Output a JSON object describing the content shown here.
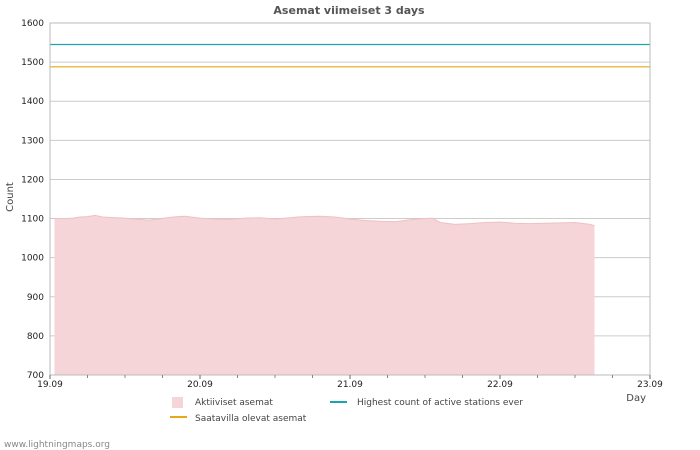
{
  "chart_data": {
    "type": "area",
    "title": "Asemat viimeiset 3 days",
    "xlabel": "Day",
    "ylabel": "Count",
    "x_ticks": [
      "19.09",
      "20.09",
      "21.09",
      "22.09",
      "23.09"
    ],
    "xlim": [
      0,
      4
    ],
    "ylim": [
      700,
      1600
    ],
    "y_ticks": [
      700,
      800,
      900,
      1000,
      1100,
      1200,
      1300,
      1400,
      1500,
      1600
    ],
    "grid": true,
    "legend_position": "bottom",
    "series": [
      {
        "name": "Aktiiviset asemat",
        "kind": "area",
        "color": "#f5d5d7",
        "x": [
          0.03,
          0.1,
          0.15,
          0.2,
          0.25,
          0.3,
          0.35,
          0.4,
          0.5,
          0.6,
          0.65,
          0.7,
          0.8,
          0.85,
          0.9,
          1.0,
          1.1,
          1.2,
          1.3,
          1.4,
          1.5,
          1.6,
          1.65,
          1.7,
          1.8,
          1.9,
          2.0,
          2.1,
          2.2,
          2.3,
          2.4,
          2.5,
          2.55,
          2.6,
          2.7,
          2.8,
          2.9,
          3.0,
          3.1,
          3.2,
          3.3,
          3.4,
          3.5,
          3.6,
          3.63
        ],
        "values": [
          1100,
          1100,
          1101,
          1104,
          1105,
          1108,
          1104,
          1103,
          1101,
          1098,
          1096,
          1098,
          1103,
          1105,
          1106,
          1101,
          1099,
          1098,
          1101,
          1102,
          1099,
          1102,
          1104,
          1105,
          1106,
          1104,
          1099,
          1095,
          1093,
          1092,
          1097,
          1100,
          1101,
          1090,
          1085,
          1087,
          1090,
          1091,
          1088,
          1087,
          1088,
          1089,
          1090,
          1085,
          1082
        ]
      },
      {
        "name": "Highest count of active stations ever",
        "kind": "line",
        "color": "#1aa3b3",
        "values": [
          1545
        ]
      },
      {
        "name": "Saatavilla olevat asemat",
        "kind": "line",
        "color": "#e6a817",
        "values": [
          1488
        ]
      }
    ]
  },
  "watermark": "www.lightningmaps.org"
}
